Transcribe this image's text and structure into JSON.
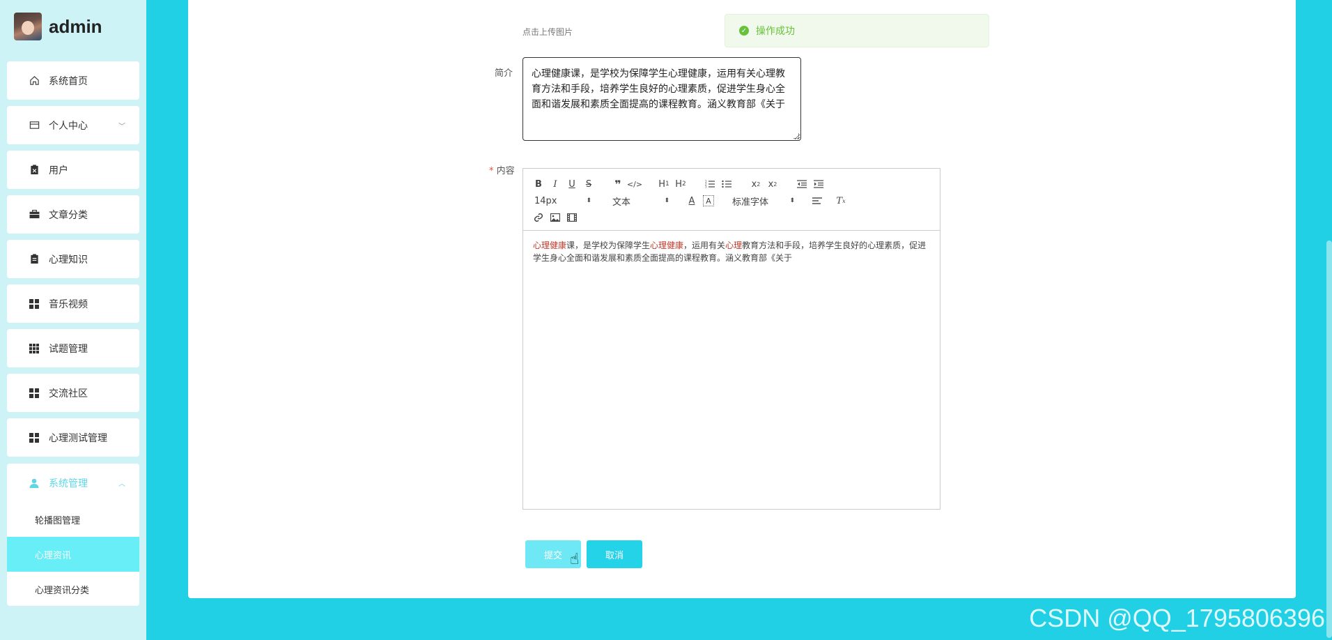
{
  "brand": {
    "name": "admin"
  },
  "sidebar": {
    "items": [
      {
        "label": "系统首页",
        "icon": "home-icon"
      },
      {
        "label": "个人中心",
        "icon": "card-icon",
        "has_chevron": true
      },
      {
        "label": "用户",
        "icon": "clipboard-icon"
      },
      {
        "label": "文章分类",
        "icon": "briefcase-icon"
      },
      {
        "label": "心理知识",
        "icon": "clipboard-icon"
      },
      {
        "label": "音乐视频",
        "icon": "grid-icon"
      },
      {
        "label": "试题管理",
        "icon": "grid9-icon"
      },
      {
        "label": "交流社区",
        "icon": "grid-icon"
      },
      {
        "label": "心理测试管理",
        "icon": "grid-icon"
      }
    ],
    "system_group": {
      "label": "系统管理",
      "icon": "user-icon",
      "expanded": true,
      "children": [
        {
          "label": "轮播图管理",
          "active": false
        },
        {
          "label": "心理资讯",
          "active": true
        },
        {
          "label": "心理资讯分类",
          "active": false
        }
      ]
    }
  },
  "form": {
    "upload_hint": "点击上传图片",
    "toast": "操作成功",
    "intro_label": "简介",
    "intro_value": "心理健康课，是学校为保障学生心理健康，运用有关心理教育方法和手段，培养学生良好的心理素质，促进学生身心全面和谐发展和素质全面提高的课程教育。涵义教育部《关于",
    "content_label": "内容",
    "content_required_mark": "*",
    "editor": {
      "font_size": "14px",
      "block_type": "文本",
      "font_family": "标准字体",
      "body_segments": [
        {
          "text": "心理健康",
          "highlight": true
        },
        {
          "text": "课，是学校为保障学生",
          "highlight": false
        },
        {
          "text": "心理健康",
          "highlight": true
        },
        {
          "text": "，运用有关",
          "highlight": false
        },
        {
          "text": "心理",
          "highlight": true
        },
        {
          "text": "教育方法和手段，培养学生良好的心理素质，促进学生身心全面和谐发展和素质全面提高的课程教育。涵义教育部《关于",
          "highlight": false
        }
      ]
    },
    "submit_label": "提交",
    "cancel_label": "取消"
  },
  "watermark": "CSDN @QQ_1795806396",
  "colors": {
    "accent": "#22d0e6",
    "sidebar_bg": "#cdf3f7",
    "active_item": "#67eef7",
    "success": "#67c23a",
    "highlight_text": "#c0392b"
  }
}
